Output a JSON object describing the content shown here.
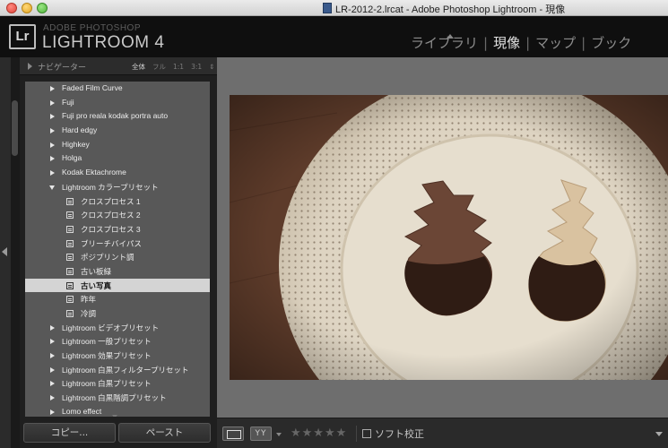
{
  "window": {
    "title": "LR-2012-2.lrcat - Adobe Photoshop Lightroom - 現像"
  },
  "identity": {
    "badge": "Lr",
    "small": "ADOBE PHOTOSHOP",
    "large": "LIGHTROOM 4"
  },
  "modules": [
    {
      "label": "ライブラリ",
      "active": false
    },
    {
      "label": "現像",
      "active": true
    },
    {
      "label": "マップ",
      "active": false
    },
    {
      "label": "ブック",
      "active": false
    }
  ],
  "navigator": {
    "title": "ナビゲーター",
    "zooms": [
      "全体",
      "フル",
      "1:1",
      "3:1"
    ],
    "active_zoom": "全体"
  },
  "presets": {
    "folders_before": [
      "Faded Film Curve",
      "Fuji",
      "Fuji pro reala kodak portra auto",
      "Hard edgy",
      "Highkey",
      "Holga",
      "Kodak Ektachrome"
    ],
    "open_folder": "Lightroom カラープリセット",
    "items": [
      "クロスプロセス 1",
      "クロスプロセス 2",
      "クロスプロセス 3",
      "ブリーチバイパス",
      "ポジプリント調",
      "古い板緑",
      "古い写真",
      "昨年",
      "冷調"
    ],
    "selected": "古い写真",
    "folders_after": [
      "Lightroom ビデオプリセット",
      "Lightroom 一般プリセット",
      "Lightroom 効果プリセット",
      "Lightroom 白黒フィルタープリセット",
      "Lightroom 白黒プリセット",
      "Lightroom 白黒階調プリセット",
      "Lomo effect"
    ]
  },
  "panel_buttons": {
    "copy": "コピー...",
    "paste": "ペースト"
  },
  "toolbar": {
    "yy": "YY",
    "stars": "★★★★★",
    "soft_proof": "ソフト校正"
  },
  "colors": {
    "panel_list_bg": "#585858",
    "selected_bg": "#d4d4d4",
    "canvas_bg": "#6e6e6e",
    "header_bg": "#0f0f0f"
  }
}
